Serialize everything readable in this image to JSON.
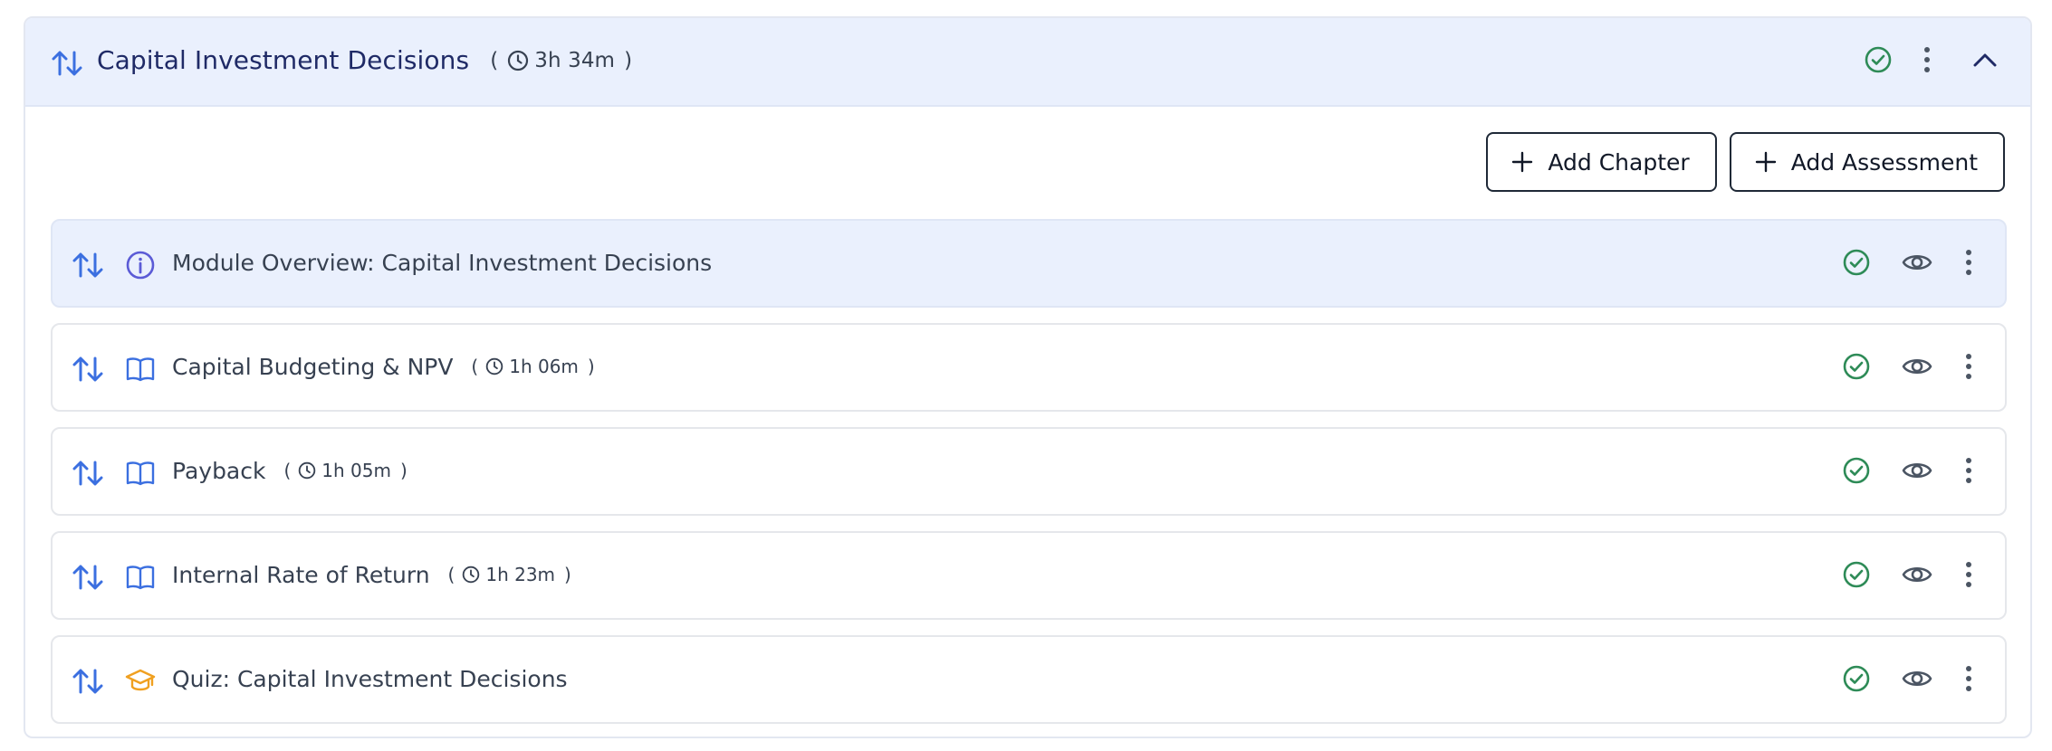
{
  "module": {
    "title": "Capital Investment Decisions",
    "duration": "3h 34m",
    "paren_open": "(",
    "paren_close": ")"
  },
  "actions": {
    "add_chapter": "Add Chapter",
    "add_assessment": "Add Assessment"
  },
  "items": [
    {
      "type": "info",
      "label": "Module Overview: Capital Investment Decisions",
      "duration": null,
      "active": true
    },
    {
      "type": "chapter",
      "label": "Capital Budgeting & NPV",
      "duration": "1h 06m",
      "active": false
    },
    {
      "type": "chapter",
      "label": "Payback",
      "duration": "1h 05m",
      "active": false
    },
    {
      "type": "chapter",
      "label": "Internal Rate of Return",
      "duration": "1h 23m",
      "active": false
    },
    {
      "type": "quiz",
      "label": "Quiz: Capital Investment Decisions",
      "duration": null,
      "active": false
    }
  ],
  "colors": {
    "accent": "#3b6fe0",
    "title": "#1f2a66",
    "success": "#2e8b57",
    "info_icon": "#5b5bd6",
    "quiz_icon": "#f0a020",
    "header_bg": "#eaf0fd"
  },
  "icons": {
    "sort": "sort-arrows-icon",
    "clock": "clock-icon",
    "check": "check-circle-icon",
    "eye": "eye-icon",
    "more": "more-vertical-icon",
    "collapse": "chevron-up-icon",
    "info": "info-icon",
    "chapter": "book-icon",
    "quiz": "graduation-cap-icon",
    "plus": "plus-icon"
  }
}
